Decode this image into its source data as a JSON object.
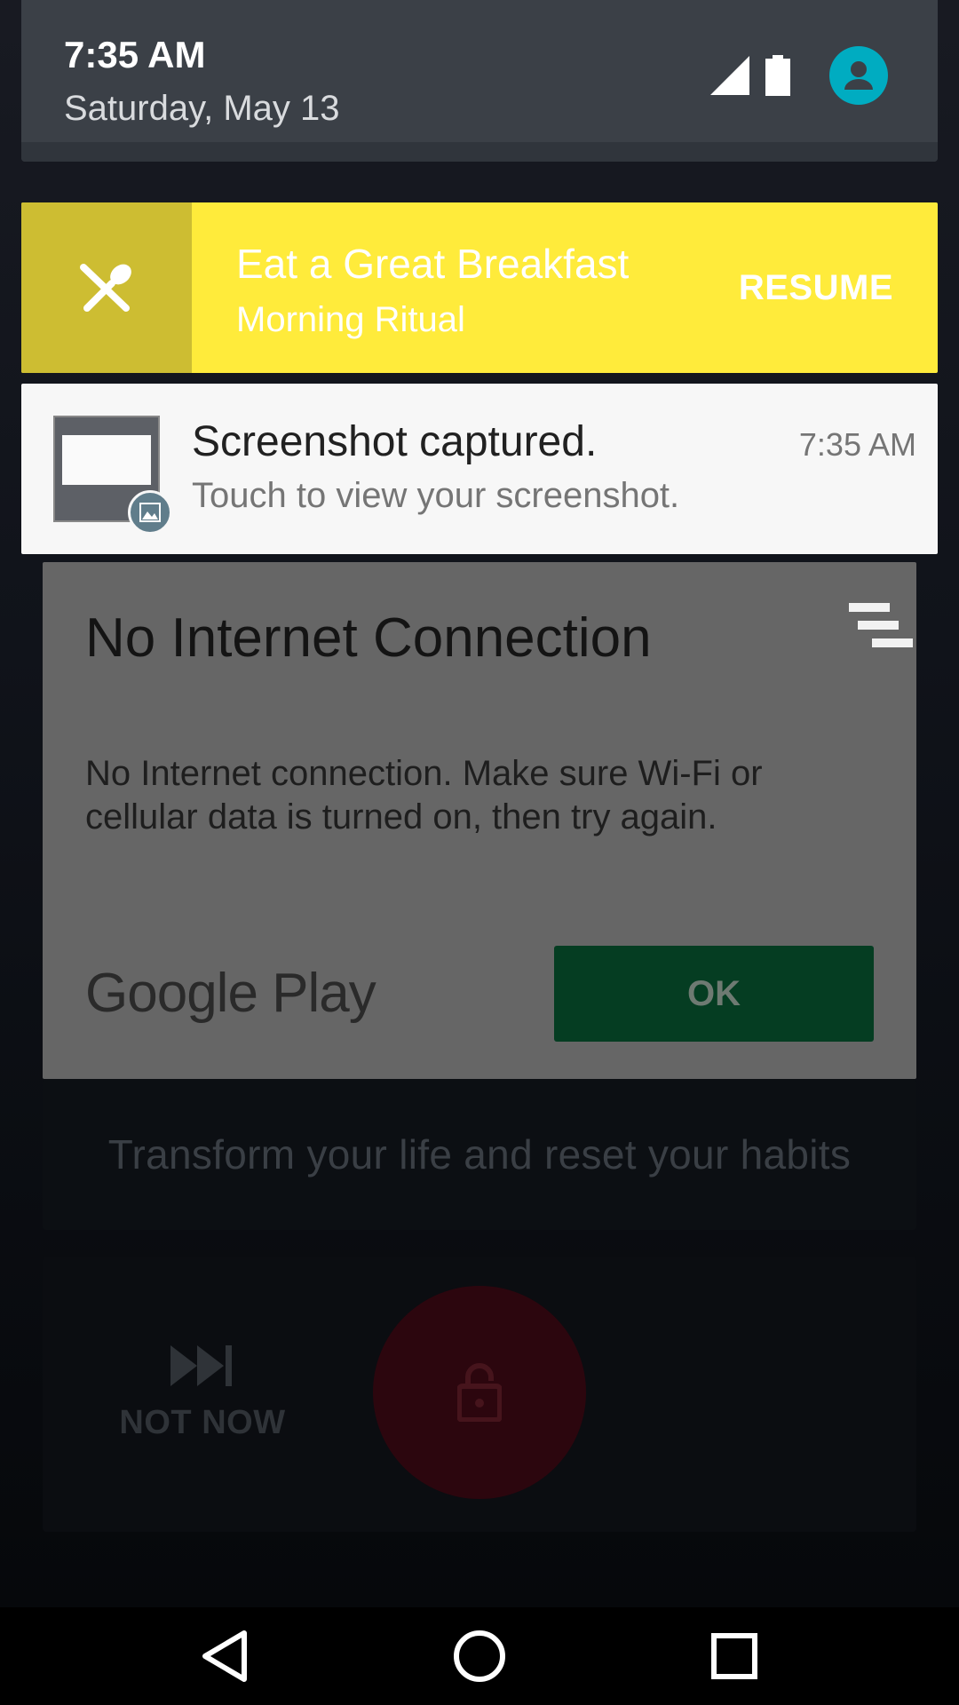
{
  "status": {
    "time": "7:35 AM",
    "date": "Saturday, May 13",
    "icons": [
      "signal-icon",
      "battery-icon",
      "account-icon"
    ],
    "accent": "#00acc1"
  },
  "ritual_notification": {
    "title": "Eat a Great Breakfast",
    "subtitle": "Morning Ritual",
    "action": "RESUME",
    "icon": "fork-knife-icon",
    "color": "#ffeb3b"
  },
  "screenshot_notification": {
    "title": "Screenshot captured.",
    "subtitle": "Touch to view your screenshot.",
    "time": "7:35 AM",
    "icon": "image-icon"
  },
  "dialog": {
    "title": "No Internet Connection",
    "body": "No Internet connection. Make sure Wi-Fi or cellular data is turned on, then try again.",
    "brand": "Google Play",
    "ok_label": "OK"
  },
  "background_app": {
    "tagline": "Transform your life and reset your habits",
    "not_now_label": "NOT NOW"
  },
  "navbar": {
    "buttons": [
      "back-icon",
      "home-icon",
      "recents-icon"
    ]
  }
}
